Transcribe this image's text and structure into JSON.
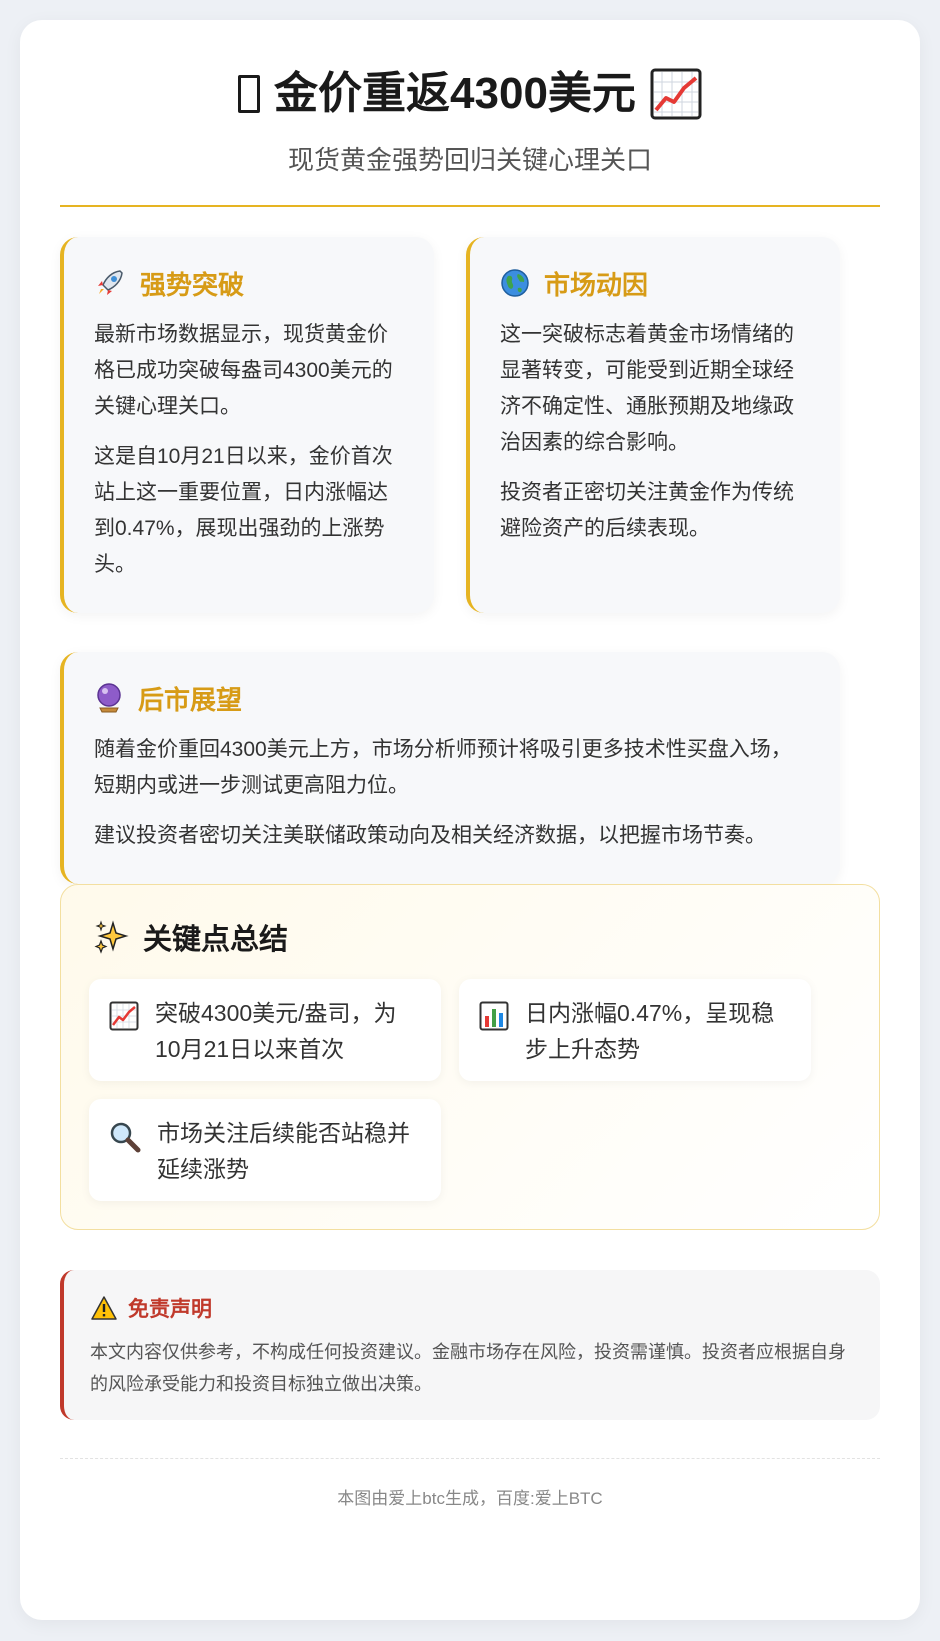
{
  "header": {
    "title": "金价重返4300美元",
    "subtitle": "现货黄金强势回归关键心理关口"
  },
  "panels": {
    "breakthrough": {
      "icon": "rocket-icon",
      "title": "强势突破",
      "paragraphs": [
        "最新市场数据显示，现货黄金价格已成功突破每盎司4300美元的关键心理关口。",
        "这是自10月21日以来，金价首次站上这一重要位置，日内涨幅达到0.47%，展现出强劲的上涨势头。"
      ]
    },
    "drivers": {
      "icon": "globe-icon",
      "title": "市场动因",
      "paragraphs": [
        "这一突破标志着黄金市场情绪的显著转变，可能受到近期全球经济不确定性、通胀预期及地缘政治因素的综合影响。",
        "投资者正密切关注黄金作为传统避险资产的后续表现。"
      ]
    },
    "outlook": {
      "icon": "crystal-ball-icon",
      "title": "后市展望",
      "paragraphs": [
        "随着金价重回4300美元上方，市场分析师预计将吸引更多技术性买盘入场，短期内或进一步测试更高阻力位。",
        "建议投资者密切关注美联储政策动向及相关经济数据，以把握市场节奏。"
      ]
    }
  },
  "summary": {
    "icon": "sparkles-icon",
    "title": "关键点总结",
    "points": [
      {
        "icon": "chart-up-icon",
        "text": "突破4300美元/盎司，为10月21日以来首次"
      },
      {
        "icon": "bar-chart-icon",
        "text": "日内涨幅0.47%，呈现稳步上升态势"
      },
      {
        "icon": "magnifier-icon",
        "text": "市场关注后续能否站稳并延续涨势"
      }
    ]
  },
  "disclaimer": {
    "icon": "warning-icon",
    "title": "免责声明",
    "text": "本文内容仅供参考，不构成任何投资建议。金融市场存在风险，投资需谨慎。投资者应根据自身的风险承受能力和投资目标独立做出决策。"
  },
  "footer": {
    "text": "本图由爱上btc生成，百度:爱上BTC"
  },
  "colors": {
    "accent": "#e6b422",
    "accent_text": "#d79b16",
    "warning": "#c0392b"
  }
}
